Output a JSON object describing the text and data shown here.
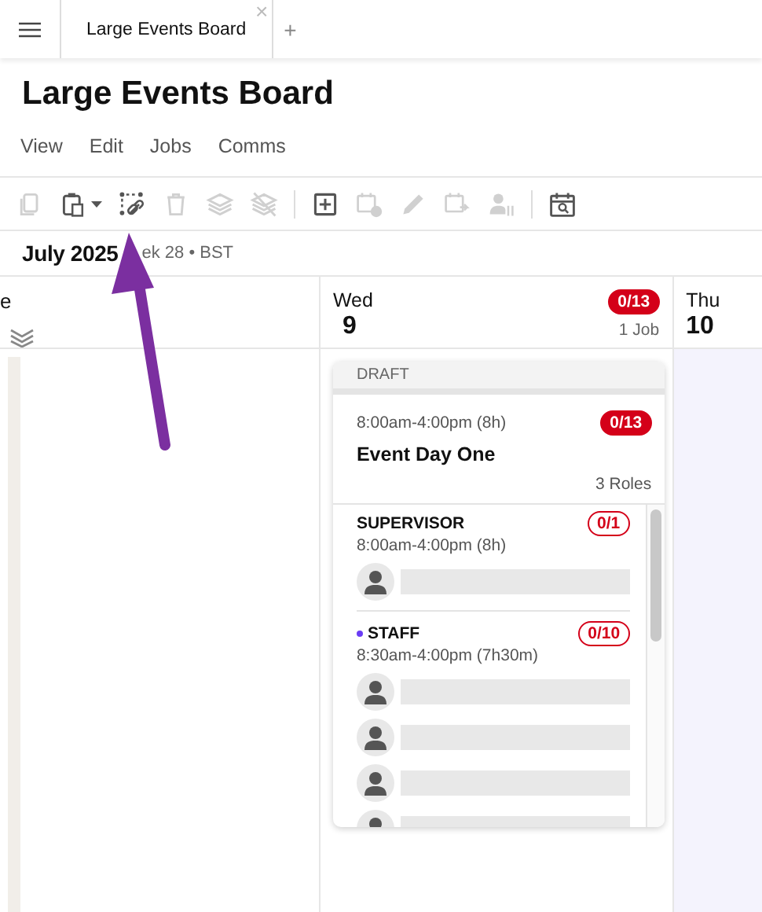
{
  "tabs": [
    {
      "label": "Large Events Board",
      "selected": true,
      "close": "×"
    }
  ],
  "new_tab": "+",
  "title": "Large Events Board",
  "menu": [
    "View",
    "Edit",
    "Jobs",
    "Comms"
  ],
  "toolbar": [
    {
      "disabled": true
    },
    {
      "disabled": false,
      "dropdown": true
    },
    {
      "disabled": false
    },
    {
      "disabled": true
    },
    {
      "disabled": true
    },
    {
      "disabled": true
    },
    {
      "kind": "separator"
    },
    {
      "disabled": false
    },
    {
      "disabled": true
    },
    {
      "disabled": true
    },
    {
      "disabled": true
    },
    {
      "disabled": true
    },
    {
      "kind": "separator"
    },
    {
      "disabled": false
    }
  ],
  "period": {
    "month": "July 2025",
    "info": "ek 28 • BST"
  },
  "days": [
    {
      "label": "e",
      "kind": "cut"
    },
    {
      "weekday": "Wed",
      "date": "9",
      "badge": "0/13",
      "jobs": "1 Job",
      "kind": "day",
      "highlighted": false
    },
    {
      "weekday": "Thu",
      "date": "10",
      "kind": "day",
      "highlighted": true
    }
  ],
  "job": {
    "status": "DRAFT",
    "time": "8:00am-4:00pm (8h)",
    "badge": "0/13",
    "name": "Event Day One",
    "roles_count": "3 Roles",
    "roles": [
      {
        "name": "SUPERVISOR",
        "marked": false,
        "badge": "0/1",
        "time": "8:00am-4:00pm (8h)",
        "slots": [
          {
            "filled": false
          }
        ]
      },
      {
        "name": "STAFF",
        "marked": true,
        "badge": "0/10",
        "time": "8:30am-4:00pm (7h30m)",
        "slots": [
          {
            "filled": false
          },
          {
            "filled": false
          },
          {
            "filled": false
          },
          {
            "filled": false
          }
        ]
      }
    ]
  }
}
